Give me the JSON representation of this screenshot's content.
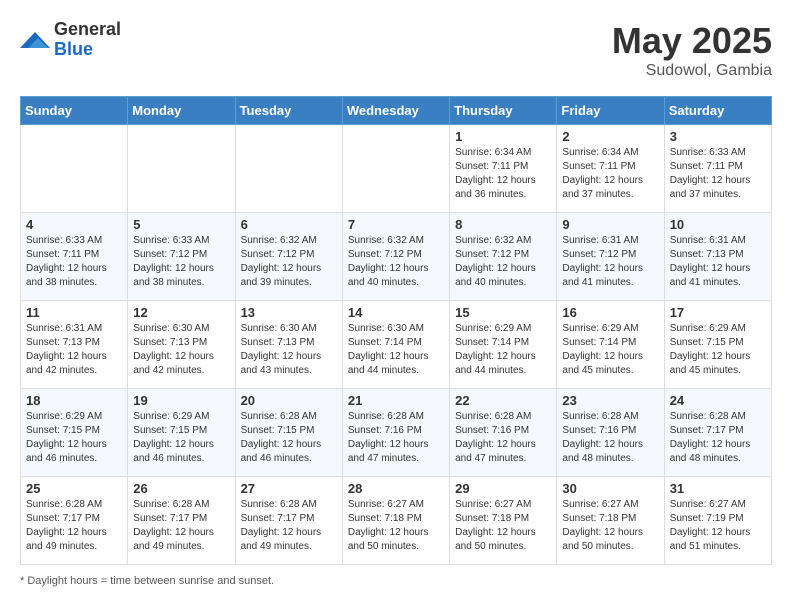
{
  "header": {
    "logo_general": "General",
    "logo_blue": "Blue",
    "title": "May 2025",
    "location": "Sudowol, Gambia"
  },
  "days_of_week": [
    "Sunday",
    "Monday",
    "Tuesday",
    "Wednesday",
    "Thursday",
    "Friday",
    "Saturday"
  ],
  "footer": {
    "note": "Daylight hours"
  },
  "weeks": [
    [
      {
        "day": "",
        "info": ""
      },
      {
        "day": "",
        "info": ""
      },
      {
        "day": "",
        "info": ""
      },
      {
        "day": "",
        "info": ""
      },
      {
        "day": "1",
        "info": "Sunrise: 6:34 AM\nSunset: 7:11 PM\nDaylight: 12 hours\nand 36 minutes."
      },
      {
        "day": "2",
        "info": "Sunrise: 6:34 AM\nSunset: 7:11 PM\nDaylight: 12 hours\nand 37 minutes."
      },
      {
        "day": "3",
        "info": "Sunrise: 6:33 AM\nSunset: 7:11 PM\nDaylight: 12 hours\nand 37 minutes."
      }
    ],
    [
      {
        "day": "4",
        "info": "Sunrise: 6:33 AM\nSunset: 7:11 PM\nDaylight: 12 hours\nand 38 minutes."
      },
      {
        "day": "5",
        "info": "Sunrise: 6:33 AM\nSunset: 7:12 PM\nDaylight: 12 hours\nand 38 minutes."
      },
      {
        "day": "6",
        "info": "Sunrise: 6:32 AM\nSunset: 7:12 PM\nDaylight: 12 hours\nand 39 minutes."
      },
      {
        "day": "7",
        "info": "Sunrise: 6:32 AM\nSunset: 7:12 PM\nDaylight: 12 hours\nand 40 minutes."
      },
      {
        "day": "8",
        "info": "Sunrise: 6:32 AM\nSunset: 7:12 PM\nDaylight: 12 hours\nand 40 minutes."
      },
      {
        "day": "9",
        "info": "Sunrise: 6:31 AM\nSunset: 7:12 PM\nDaylight: 12 hours\nand 41 minutes."
      },
      {
        "day": "10",
        "info": "Sunrise: 6:31 AM\nSunset: 7:13 PM\nDaylight: 12 hours\nand 41 minutes."
      }
    ],
    [
      {
        "day": "11",
        "info": "Sunrise: 6:31 AM\nSunset: 7:13 PM\nDaylight: 12 hours\nand 42 minutes."
      },
      {
        "day": "12",
        "info": "Sunrise: 6:30 AM\nSunset: 7:13 PM\nDaylight: 12 hours\nand 42 minutes."
      },
      {
        "day": "13",
        "info": "Sunrise: 6:30 AM\nSunset: 7:13 PM\nDaylight: 12 hours\nand 43 minutes."
      },
      {
        "day": "14",
        "info": "Sunrise: 6:30 AM\nSunset: 7:14 PM\nDaylight: 12 hours\nand 44 minutes."
      },
      {
        "day": "15",
        "info": "Sunrise: 6:29 AM\nSunset: 7:14 PM\nDaylight: 12 hours\nand 44 minutes."
      },
      {
        "day": "16",
        "info": "Sunrise: 6:29 AM\nSunset: 7:14 PM\nDaylight: 12 hours\nand 45 minutes."
      },
      {
        "day": "17",
        "info": "Sunrise: 6:29 AM\nSunset: 7:15 PM\nDaylight: 12 hours\nand 45 minutes."
      }
    ],
    [
      {
        "day": "18",
        "info": "Sunrise: 6:29 AM\nSunset: 7:15 PM\nDaylight: 12 hours\nand 46 minutes."
      },
      {
        "day": "19",
        "info": "Sunrise: 6:29 AM\nSunset: 7:15 PM\nDaylight: 12 hours\nand 46 minutes."
      },
      {
        "day": "20",
        "info": "Sunrise: 6:28 AM\nSunset: 7:15 PM\nDaylight: 12 hours\nand 46 minutes."
      },
      {
        "day": "21",
        "info": "Sunrise: 6:28 AM\nSunset: 7:16 PM\nDaylight: 12 hours\nand 47 minutes."
      },
      {
        "day": "22",
        "info": "Sunrise: 6:28 AM\nSunset: 7:16 PM\nDaylight: 12 hours\nand 47 minutes."
      },
      {
        "day": "23",
        "info": "Sunrise: 6:28 AM\nSunset: 7:16 PM\nDaylight: 12 hours\nand 48 minutes."
      },
      {
        "day": "24",
        "info": "Sunrise: 6:28 AM\nSunset: 7:17 PM\nDaylight: 12 hours\nand 48 minutes."
      }
    ],
    [
      {
        "day": "25",
        "info": "Sunrise: 6:28 AM\nSunset: 7:17 PM\nDaylight: 12 hours\nand 49 minutes."
      },
      {
        "day": "26",
        "info": "Sunrise: 6:28 AM\nSunset: 7:17 PM\nDaylight: 12 hours\nand 49 minutes."
      },
      {
        "day": "27",
        "info": "Sunrise: 6:28 AM\nSunset: 7:17 PM\nDaylight: 12 hours\nand 49 minutes."
      },
      {
        "day": "28",
        "info": "Sunrise: 6:27 AM\nSunset: 7:18 PM\nDaylight: 12 hours\nand 50 minutes."
      },
      {
        "day": "29",
        "info": "Sunrise: 6:27 AM\nSunset: 7:18 PM\nDaylight: 12 hours\nand 50 minutes."
      },
      {
        "day": "30",
        "info": "Sunrise: 6:27 AM\nSunset: 7:18 PM\nDaylight: 12 hours\nand 50 minutes."
      },
      {
        "day": "31",
        "info": "Sunrise: 6:27 AM\nSunset: 7:19 PM\nDaylight: 12 hours\nand 51 minutes."
      }
    ]
  ]
}
